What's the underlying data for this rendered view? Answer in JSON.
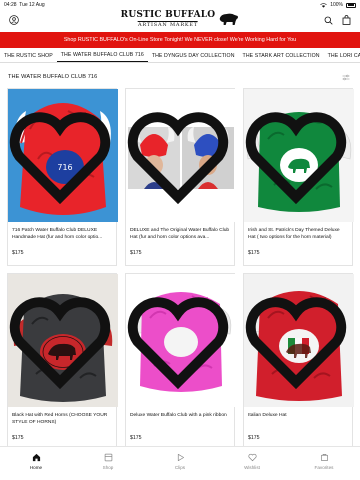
{
  "status": {
    "time": "04:28",
    "date": "Tue 12 Aug",
    "battery": "100%"
  },
  "header": {
    "logo_line1": "RUSTIC BUFFALO",
    "logo_line2": "ARTISAN MARKET"
  },
  "announcement": "Shop RUSTIC BUFFALO's On-Line Store Tonight! We NEVER close! We're Working Hard for You",
  "tabs": [
    {
      "label": "THE RUSTIC SHOP",
      "active": false
    },
    {
      "label": "THE WATER BUFFALO CLUB 716",
      "active": true
    },
    {
      "label": "THE DYNGUS DAY COLLECTION",
      "active": false
    },
    {
      "label": "THE STARK ART COLLECTION",
      "active": false
    },
    {
      "label": "THE LORI CAP",
      "active": false
    }
  ],
  "collection": {
    "title": "THE WATER BUFFALO CLUB 716"
  },
  "products": [
    {
      "name": "716 Patch Water Buffalo Club DELUXE Handmade Hat (fur and horn color optio...",
      "price": "$175"
    },
    {
      "name": "DELUXE and The Original Water Buffalo Club Hat (fur and horn color options ava...",
      "price": "$175"
    },
    {
      "name": "Irish and St. Patrick's Day Themed Deluxe Hat ( two options for the horn material)",
      "price": "$175"
    },
    {
      "name": "Black Hat with Red Horns (CHOOSE YOUR STYLE OF HORNS)",
      "price": "$175"
    },
    {
      "name": "Deluxe Water Buffalo Club with a pink ribbon",
      "price": "$175"
    },
    {
      "name": "Italian Deluxe Hat",
      "price": "$175"
    }
  ],
  "patch_text": "716",
  "bottom_nav": [
    {
      "label": "Home",
      "icon": "home-icon",
      "active": true
    },
    {
      "label": "Shop",
      "icon": "shop-icon",
      "active": false
    },
    {
      "label": "Clips",
      "icon": "clips-icon",
      "active": false
    },
    {
      "label": "Wishlist",
      "icon": "heart-icon",
      "active": false
    },
    {
      "label": "Favorites",
      "icon": "favorites-icon",
      "active": false
    }
  ],
  "colors": {
    "announcement_bg": "#e1140f",
    "accent": "#111111"
  }
}
